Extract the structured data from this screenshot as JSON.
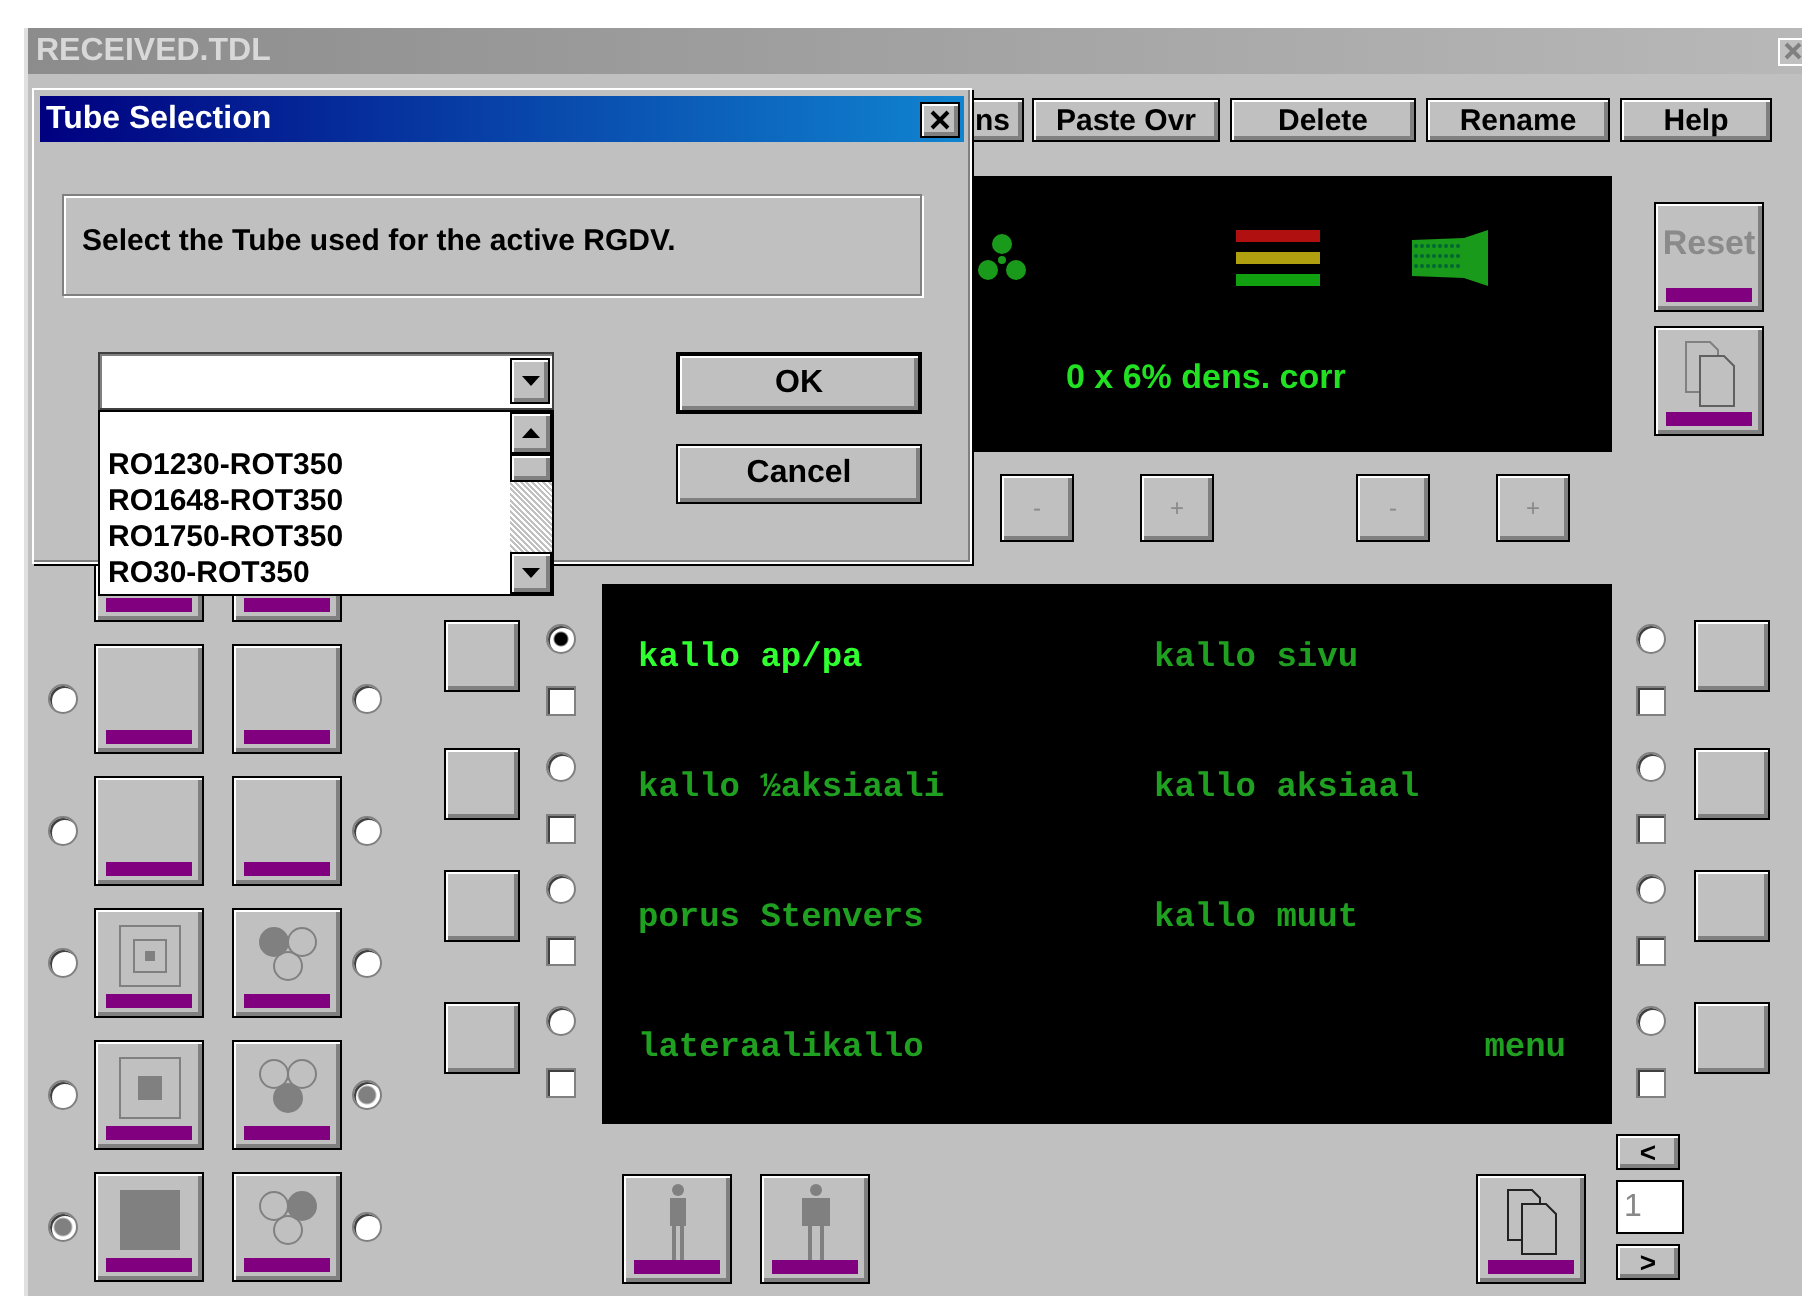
{
  "window": {
    "title": "RECEIVED.TDL"
  },
  "toolbar": [
    {
      "label": "ns"
    },
    {
      "label": "Paste Ovr"
    },
    {
      "label": "Delete"
    },
    {
      "label": "Rename"
    },
    {
      "label": "Help"
    }
  ],
  "display": {
    "reading": "0 x 6% dens. corr"
  },
  "reset_button": {
    "label": "Reset",
    "disabled": true
  },
  "adjust_buttons": [
    {
      "label": "-"
    },
    {
      "label": "+"
    },
    {
      "label": "-"
    },
    {
      "label": "+"
    }
  ],
  "tile_rows": [
    {
      "tiles": [
        {
          "kind": "blank"
        },
        {
          "kind": "blank"
        }
      ]
    },
    {
      "tiles": [
        {
          "kind": "blank",
          "selected": false
        },
        {
          "kind": "blank",
          "selected": false
        }
      ]
    },
    {
      "tiles": [
        {
          "kind": "blank",
          "selected": false
        },
        {
          "kind": "blank",
          "selected": false
        }
      ]
    },
    {
      "tiles": [
        {
          "kind": "field-small",
          "selected": false
        },
        {
          "kind": "chambers-left",
          "selected": false
        }
      ]
    },
    {
      "tiles": [
        {
          "kind": "field-medium",
          "selected": false
        },
        {
          "kind": "chambers-bottom",
          "selected": true
        }
      ]
    },
    {
      "tiles": [
        {
          "kind": "field-large",
          "selected": true
        },
        {
          "kind": "chambers-right",
          "selected": false
        }
      ]
    }
  ],
  "mid_rows": [
    {
      "selected": true,
      "checked": false
    },
    {
      "selected": false,
      "checked": false
    },
    {
      "selected": false,
      "checked": false
    },
    {
      "selected": false,
      "checked": false
    }
  ],
  "programs": [
    {
      "label": "kallo ap/pa",
      "selected": true,
      "kind": "program"
    },
    {
      "label": "kallo sivu",
      "selected": false,
      "kind": "program"
    },
    {
      "label": "kallo ½aksiaali",
      "selected": false,
      "kind": "program"
    },
    {
      "label": "kallo aksiaal",
      "selected": false,
      "kind": "program"
    },
    {
      "label": "porus Stenvers",
      "selected": false,
      "kind": "program"
    },
    {
      "label": "kallo muut",
      "selected": false,
      "kind": "program"
    },
    {
      "label": "lateraalikallo",
      "selected": false,
      "kind": "program"
    },
    {
      "label": "menu",
      "selected": false,
      "kind": "menu"
    }
  ],
  "right_rows": [
    {
      "selected": false,
      "checked": false
    },
    {
      "selected": false,
      "checked": false
    },
    {
      "selected": false,
      "checked": false
    },
    {
      "selected": false,
      "checked": false
    }
  ],
  "patient_buttons": [
    {
      "kind": "slim"
    },
    {
      "kind": "broad"
    }
  ],
  "pager": {
    "prev": "<",
    "value": "1",
    "next": ">"
  },
  "dialog": {
    "title": "Tube Selection",
    "message": "Select the Tube used for the active RGDV.",
    "options": [
      "RO1230-ROT350",
      "RO1648-ROT350",
      "RO1750-ROT350",
      "RO30-ROT350"
    ],
    "buttons": [
      {
        "label": "OK",
        "default": true
      },
      {
        "label": "Cancel",
        "default": false
      }
    ]
  }
}
